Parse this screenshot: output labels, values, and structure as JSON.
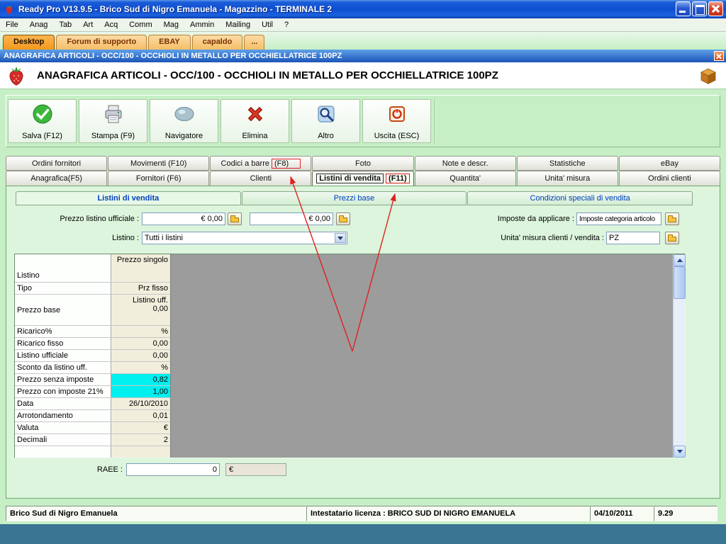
{
  "window": {
    "title": "Ready Pro V13.9.5 - Brico Sud di Nigro Emanuela - Magazzino - TERMINALE 2"
  },
  "menu": {
    "items": [
      "File",
      "Anag",
      "Tab",
      "Art",
      "Acq",
      "Comm",
      "Mag",
      "Ammin",
      "Mailing",
      "Util",
      "?"
    ]
  },
  "session_tabs": {
    "items": [
      "Desktop",
      "Forum di supporto",
      "EBAY",
      "capaldo",
      "..."
    ]
  },
  "banner": {
    "title": "ANAGRAFICA ARTICOLI - OCC/100 -  OCCHIOLI IN METALLO PER OCCHIELLATRICE 100PZ"
  },
  "page_header": {
    "title": "ANAGRAFICA ARTICOLI - OCC/100 -  OCCHIOLI IN METALLO PER OCCHIELLATRICE 100PZ"
  },
  "toolbar": {
    "buttons": [
      {
        "label": "Salva (F12)",
        "icon": "green-check-icon"
      },
      {
        "label": "Stampa (F9)",
        "icon": "printer-icon"
      },
      {
        "label": "Navigatore",
        "icon": "globe-icon"
      },
      {
        "label": "Elimina",
        "icon": "red-x-icon"
      },
      {
        "label": "Altro",
        "icon": "magnifier-icon"
      },
      {
        "label": "Uscita (ESC)",
        "icon": "exit-icon"
      }
    ]
  },
  "tabs_top": {
    "items": [
      {
        "label": "Ordini fornitori"
      },
      {
        "label": "Movimenti (F10)"
      },
      {
        "label": "Codici a barre",
        "fkey": "(F8)"
      },
      {
        "label": "Foto"
      },
      {
        "label": "Note e descr."
      },
      {
        "label": "Statistiche"
      },
      {
        "label": "eBay"
      }
    ]
  },
  "tabs_bottom": {
    "items": [
      {
        "label": "Anagrafica(F5)"
      },
      {
        "label": "Fornitori (F6)"
      },
      {
        "label": "Clienti"
      },
      {
        "label": "Listini di vendita",
        "fkey": "(F11)"
      },
      {
        "label": "Quantita'"
      },
      {
        "label": "Unita' misura"
      },
      {
        "label": "Ordini clienti"
      }
    ]
  },
  "subtabs": {
    "items": [
      "Listini di vendita",
      "Prezzi base",
      "Condizioni speciali di vendita"
    ]
  },
  "form": {
    "prezzo_listino_label": "Prezzo listino ufficiale :",
    "prezzo_listino_value1": "€ 0,00",
    "prezzo_listino_value2": "€ 0,00",
    "listino_label": "Listino :",
    "listino_value": "Tutti i listini",
    "imposte_label": "Imposte da applicare :",
    "imposte_value": "Imposte categoria articolo",
    "unita_label": "Unita' misura clienti / vendita :",
    "unita_value": "PZ"
  },
  "price_table": {
    "rows": [
      {
        "label": "Listino",
        "value": "Prezzo singolo"
      },
      {
        "label": "Tipo",
        "value": "Prz fisso"
      },
      {
        "label": "Prezzo base",
        "value": "Listino uff.\n0,00"
      },
      {
        "label": "Ricarico%",
        "value": "%"
      },
      {
        "label": "Ricarico fisso",
        "value": "0,00"
      },
      {
        "label": "Listino ufficiale",
        "value": "0,00"
      },
      {
        "label": "Sconto da listino uff.",
        "value": "%"
      },
      {
        "label": "Prezzo senza imposte",
        "value": "0,82"
      },
      {
        "label": "Prezzo con imposte 21%",
        "value": "1,00"
      },
      {
        "label": "Data",
        "value": "26/10/2010"
      },
      {
        "label": "Arrotondamento",
        "value": "0,01"
      },
      {
        "label": "Valuta",
        "value": "€"
      },
      {
        "label": "Decimali",
        "value": "2"
      }
    ]
  },
  "raee": {
    "label": "RAEE :",
    "value": "0",
    "currency": "€"
  },
  "statusbar": {
    "company": "Brico Sud di Nigro Emanuela",
    "license": "Intestatario licenza : BRICO SUD DI NIGRO EMANUELA",
    "date": "04/10/2011",
    "time": "9.29"
  },
  "colors": {
    "background_green": "#C6EFC6",
    "session_tab_orange": "#F3991C",
    "highlight_cyan": "#00F0F0",
    "annotation_red": "#E02020",
    "titlebar_blue": "#0E4FD0"
  }
}
